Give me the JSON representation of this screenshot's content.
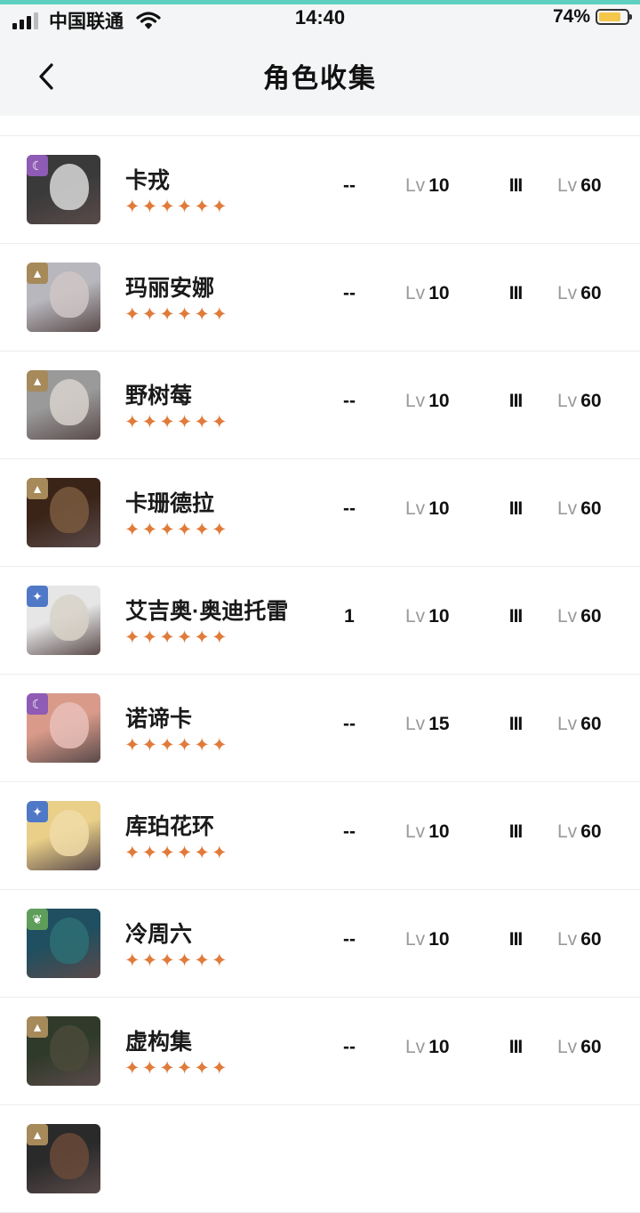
{
  "status_bar": {
    "carrier": "中国联通",
    "time": "14:40",
    "battery": "74%"
  },
  "nav": {
    "title": "角色收集"
  },
  "lv_label": "Lv",
  "characters": [
    {
      "name": "卡戎",
      "stars": "✦✦✦✦✦✦",
      "value": "--",
      "level": "10",
      "tier": "III",
      "max_level": "60",
      "badge": "moon",
      "badge_color": "#8e5bb5"
    },
    {
      "name": "玛丽安娜",
      "stars": "✦✦✦✦✦✦",
      "value": "--",
      "level": "10",
      "tier": "III",
      "max_level": "60",
      "badge": "mountain",
      "badge_color": "#a78a5a"
    },
    {
      "name": "野树莓",
      "stars": "✦✦✦✦✦✦",
      "value": "--",
      "level": "10",
      "tier": "III",
      "max_level": "60",
      "badge": "mountain",
      "badge_color": "#a78a5a"
    },
    {
      "name": "卡珊德拉",
      "stars": "✦✦✦✦✦✦",
      "value": "--",
      "level": "10",
      "tier": "III",
      "max_level": "60",
      "badge": "mountain",
      "badge_color": "#a78a5a"
    },
    {
      "name": "艾吉奥·奥迪托雷",
      "stars": "✦✦✦✦✦✦",
      "value": "1",
      "level": "10",
      "tier": "III",
      "max_level": "60",
      "badge": "star",
      "badge_color": "#4f79c7"
    },
    {
      "name": "诺谛卡",
      "stars": "✦✦✦✦✦✦",
      "value": "--",
      "level": "15",
      "tier": "III",
      "max_level": "60",
      "badge": "moon",
      "badge_color": "#8e5bb5"
    },
    {
      "name": "库珀花环",
      "stars": "✦✦✦✦✦✦",
      "value": "--",
      "level": "10",
      "tier": "III",
      "max_level": "60",
      "badge": "star",
      "badge_color": "#4f79c7"
    },
    {
      "name": "冷周六",
      "stars": "✦✦✦✦✦✦",
      "value": "--",
      "level": "10",
      "tier": "III",
      "max_level": "60",
      "badge": "leaf",
      "badge_color": "#5f9e5a"
    },
    {
      "name": "虚构集",
      "stars": "✦✦✦✦✦✦",
      "value": "--",
      "level": "10",
      "tier": "III",
      "max_level": "60",
      "badge": "mountain",
      "badge_color": "#a78a5a"
    },
    {
      "name": "",
      "stars": "",
      "value": "",
      "level": "",
      "tier": "",
      "max_level": "",
      "badge": "mountain",
      "badge_color": "#a78a5a"
    }
  ]
}
